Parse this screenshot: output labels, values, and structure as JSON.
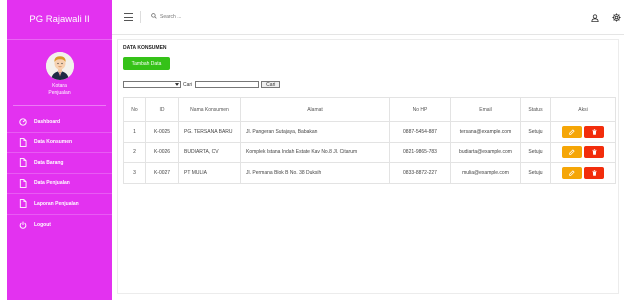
{
  "sidebar": {
    "brand": "PG Rajawali II",
    "user_role_line1": "Kotara",
    "user_role_line2": "Penjualan",
    "items": [
      {
        "label": "Dashboard",
        "icon": "gauge-icon"
      },
      {
        "label": "Data Konsumen",
        "icon": "file-icon"
      },
      {
        "label": "Data Barang",
        "icon": "file-icon"
      },
      {
        "label": "Data Penjualan",
        "icon": "file-icon"
      },
      {
        "label": "Laporan Penjualan",
        "icon": "file-icon"
      },
      {
        "label": "Logout",
        "icon": "power-icon"
      }
    ]
  },
  "topbar": {
    "search_placeholder": "Search ...",
    "icons": [
      "menu-icon",
      "search-icon",
      "user-icon",
      "settings-icon"
    ]
  },
  "content": {
    "title": "DATA KONSUMEN",
    "add_button": "Tambah Data",
    "filter_label": "Cari",
    "cari_button": "Cari"
  },
  "table": {
    "headers": [
      "No",
      "ID",
      "Nama Konsumen",
      "Alamat",
      "No HP",
      "Email",
      "Status",
      "Aksi"
    ],
    "rows": [
      {
        "no": "1",
        "id": "K-0025",
        "nama": "PG. TERSANA BARU",
        "alamat": "Jl. Pangeran Sutajaya, Babakan",
        "hp": "0887-5454-887",
        "email": "tersana@example.com",
        "status": "Setuju"
      },
      {
        "no": "2",
        "id": "K-0026",
        "nama": "BUDIARTA, CV",
        "alamat": "Komplek Istana Indah Estate Kav No.8 Jl. Citarum",
        "hp": "0821-9865-783",
        "email": "budiarta@example.com",
        "status": "Setuju"
      },
      {
        "no": "3",
        "id": "K-0027",
        "nama": "PT MULIA",
        "alamat": "Jl. Permana Blok B No. 38 Duksih",
        "hp": "0833-8872-227",
        "email": "mulia@example.com",
        "status": "Setuju"
      }
    ]
  },
  "colors": {
    "sidebar": "#e332f0",
    "add_button": "#35c218",
    "edit_button": "#f5a607",
    "delete_button": "#f22d0c"
  }
}
